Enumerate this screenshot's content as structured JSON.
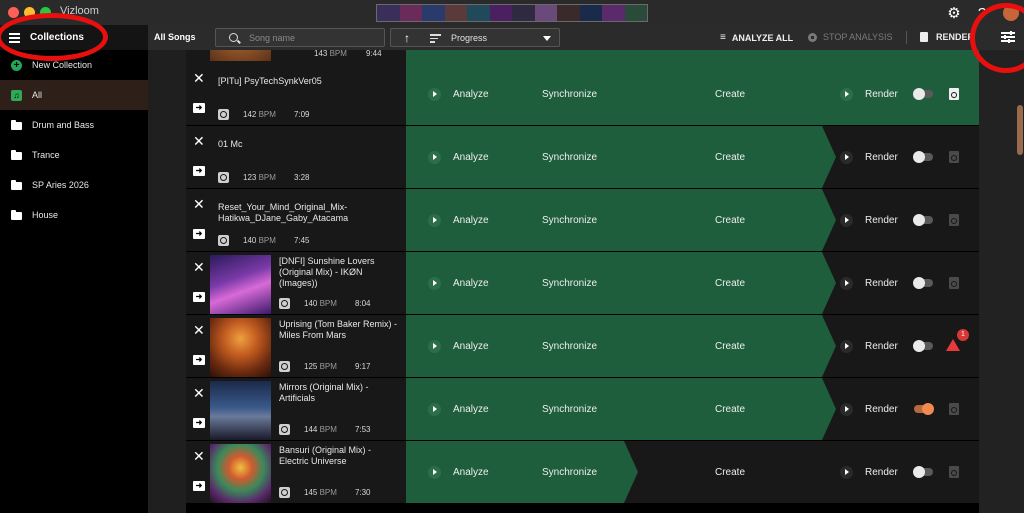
{
  "window": {
    "app_name": "Vizloom",
    "settings_icon": "gear-icon",
    "help_icon": "help-circle-icon"
  },
  "sidebar": {
    "title": "Collections",
    "items": [
      {
        "label": "New Collection",
        "icon": "add-circle-icon"
      },
      {
        "label": "All",
        "icon": "music-library-icon",
        "active": true
      },
      {
        "label": "Drum and Bass",
        "icon": "folder-icon"
      },
      {
        "label": "Trance",
        "icon": "folder-icon"
      },
      {
        "label": "SP Aries 2026",
        "icon": "folder-icon"
      },
      {
        "label": "House",
        "icon": "folder-icon"
      }
    ]
  },
  "toolbar": {
    "all_songs": "All Songs",
    "search_placeholder": "Song name",
    "sort_label": "Progress",
    "analyze_all": "ANALYZE ALL",
    "stop_analysis": "STOP ANALYSIS",
    "render": "RENDER"
  },
  "partial_row": {
    "bpm": "143",
    "duration": "9:44"
  },
  "bpm_unit": "BPM",
  "stage_labels": {
    "analyze": "Analyze",
    "synchronize": "Synchronize",
    "create": "Create",
    "render": "Render"
  },
  "songs": [
    {
      "title": "[PITu] PsyTechSynkVer05",
      "bpm": "142",
      "duration": "7:09",
      "cover": null,
      "done": [
        "analyze",
        "synchronize",
        "create",
        "render"
      ],
      "render_enabled": false,
      "status": "ready"
    },
    {
      "title": "01 Mc",
      "bpm": "123",
      "duration": "3:28",
      "cover": null,
      "done": [
        "analyze",
        "synchronize",
        "create"
      ],
      "render_enabled": false,
      "status": "none"
    },
    {
      "title": "Reset_Your_Mind_Original_Mix-Hatikwa_DJane_Gaby_Atacama",
      "bpm": "140",
      "duration": "7:45",
      "cover": null,
      "done": [
        "analyze",
        "synchronize",
        "create"
      ],
      "render_enabled": false,
      "status": "none"
    },
    {
      "title": "[DNFI] Sunshine Lovers (Original Mix) - IKØN (Images))",
      "bpm": "140",
      "duration": "8:04",
      "cover": "purple",
      "done": [
        "analyze",
        "synchronize",
        "create"
      ],
      "render_enabled": false,
      "status": "none"
    },
    {
      "title": "Uprising (Tom Baker Remix) - Miles From Mars",
      "bpm": "125",
      "duration": "9:17",
      "cover": "orange",
      "done": [
        "analyze",
        "synchronize",
        "create"
      ],
      "render_enabled": false,
      "status": "error",
      "badge": "1"
    },
    {
      "title": "Mirrors (Original Mix) - Artificials",
      "bpm": "144",
      "duration": "7:53",
      "cover": "blue",
      "done": [
        "analyze",
        "synchronize",
        "create"
      ],
      "render_enabled": true,
      "status": "none"
    },
    {
      "title": "Bansuri (Original Mix) - Electric Universe",
      "bpm": "145",
      "duration": "7:30",
      "cover": "colorful",
      "done": [
        "analyze",
        "synchronize"
      ],
      "render_enabled": false,
      "status": "none"
    }
  ],
  "colors": {
    "accent_green": "#1e5e3c",
    "highlight_red": "#e8100e",
    "toggle_on": "#f08a4f"
  }
}
